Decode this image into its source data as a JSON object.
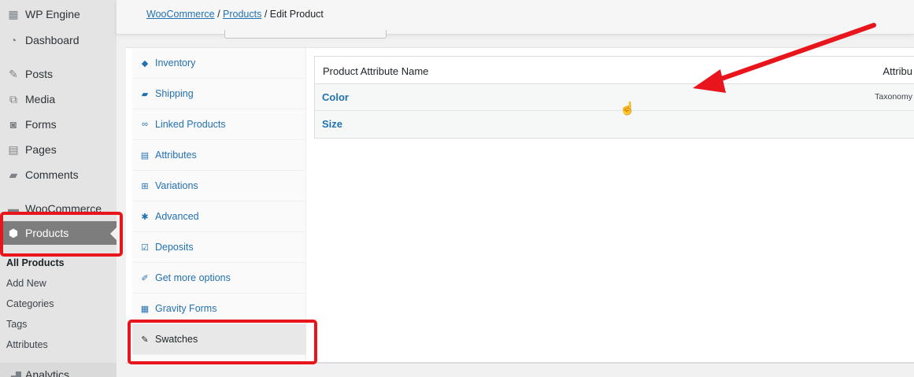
{
  "sidebar": {
    "items": [
      {
        "label": "WP Engine",
        "icon": "wp-engine-icon",
        "glyph": "▦"
      },
      {
        "label": "Dashboard",
        "icon": "dashboard-icon",
        "glyph": "◔"
      },
      {
        "label": "Posts",
        "icon": "pushpin-icon",
        "glyph": "✎"
      },
      {
        "label": "Media",
        "icon": "media-icon",
        "glyph": "⧉"
      },
      {
        "label": "Forms",
        "icon": "forms-icon",
        "glyph": "◙"
      },
      {
        "label": "Pages",
        "icon": "pages-icon",
        "glyph": "▤"
      },
      {
        "label": "Comments",
        "icon": "comments-icon",
        "glyph": "▰"
      },
      {
        "label": "WooCommerce",
        "icon": "woocommerce-icon",
        "glyph": "▬"
      },
      {
        "label": "Products",
        "icon": "products-icon",
        "glyph": "⬢"
      },
      {
        "label": "Analytics",
        "icon": "analytics-icon",
        "glyph": "▁▃▇"
      }
    ],
    "submenu": [
      "All Products",
      "Add New",
      "Categories",
      "Tags",
      "Attributes"
    ]
  },
  "breadcrumb": {
    "woocommerce": "WooCommerce",
    "sep1": " / ",
    "products": "Products",
    "sep2": " / ",
    "current": "Edit Product"
  },
  "product_tabs": [
    {
      "label": "Inventory",
      "icon": "inventory-icon",
      "glyph": "◆"
    },
    {
      "label": "Shipping",
      "icon": "truck-icon",
      "glyph": "▰"
    },
    {
      "label": "Linked Products",
      "icon": "link-icon",
      "glyph": "∞"
    },
    {
      "label": "Attributes",
      "icon": "attributes-icon",
      "glyph": "▤"
    },
    {
      "label": "Variations",
      "icon": "grid-icon",
      "glyph": "⊞"
    },
    {
      "label": "Advanced",
      "icon": "gear-icon",
      "glyph": "✱"
    },
    {
      "label": "Deposits",
      "icon": "calendar-icon",
      "glyph": "☑"
    },
    {
      "label": "Get more options",
      "icon": "plug-icon",
      "glyph": "✐"
    },
    {
      "label": "Gravity Forms",
      "icon": "gravity-forms-icon",
      "glyph": "▦"
    },
    {
      "label": "Swatches",
      "icon": "wrench-icon",
      "glyph": "✎"
    }
  ],
  "attributes_table": {
    "header_name": "Product Attribute Name",
    "header_type": "Attribu",
    "rows": [
      {
        "name": "Color",
        "type": "Taxonomy"
      },
      {
        "name": "Size",
        "type": ""
      }
    ]
  },
  "annotation_color": "#e8161c",
  "accent_color": "#2271b1"
}
